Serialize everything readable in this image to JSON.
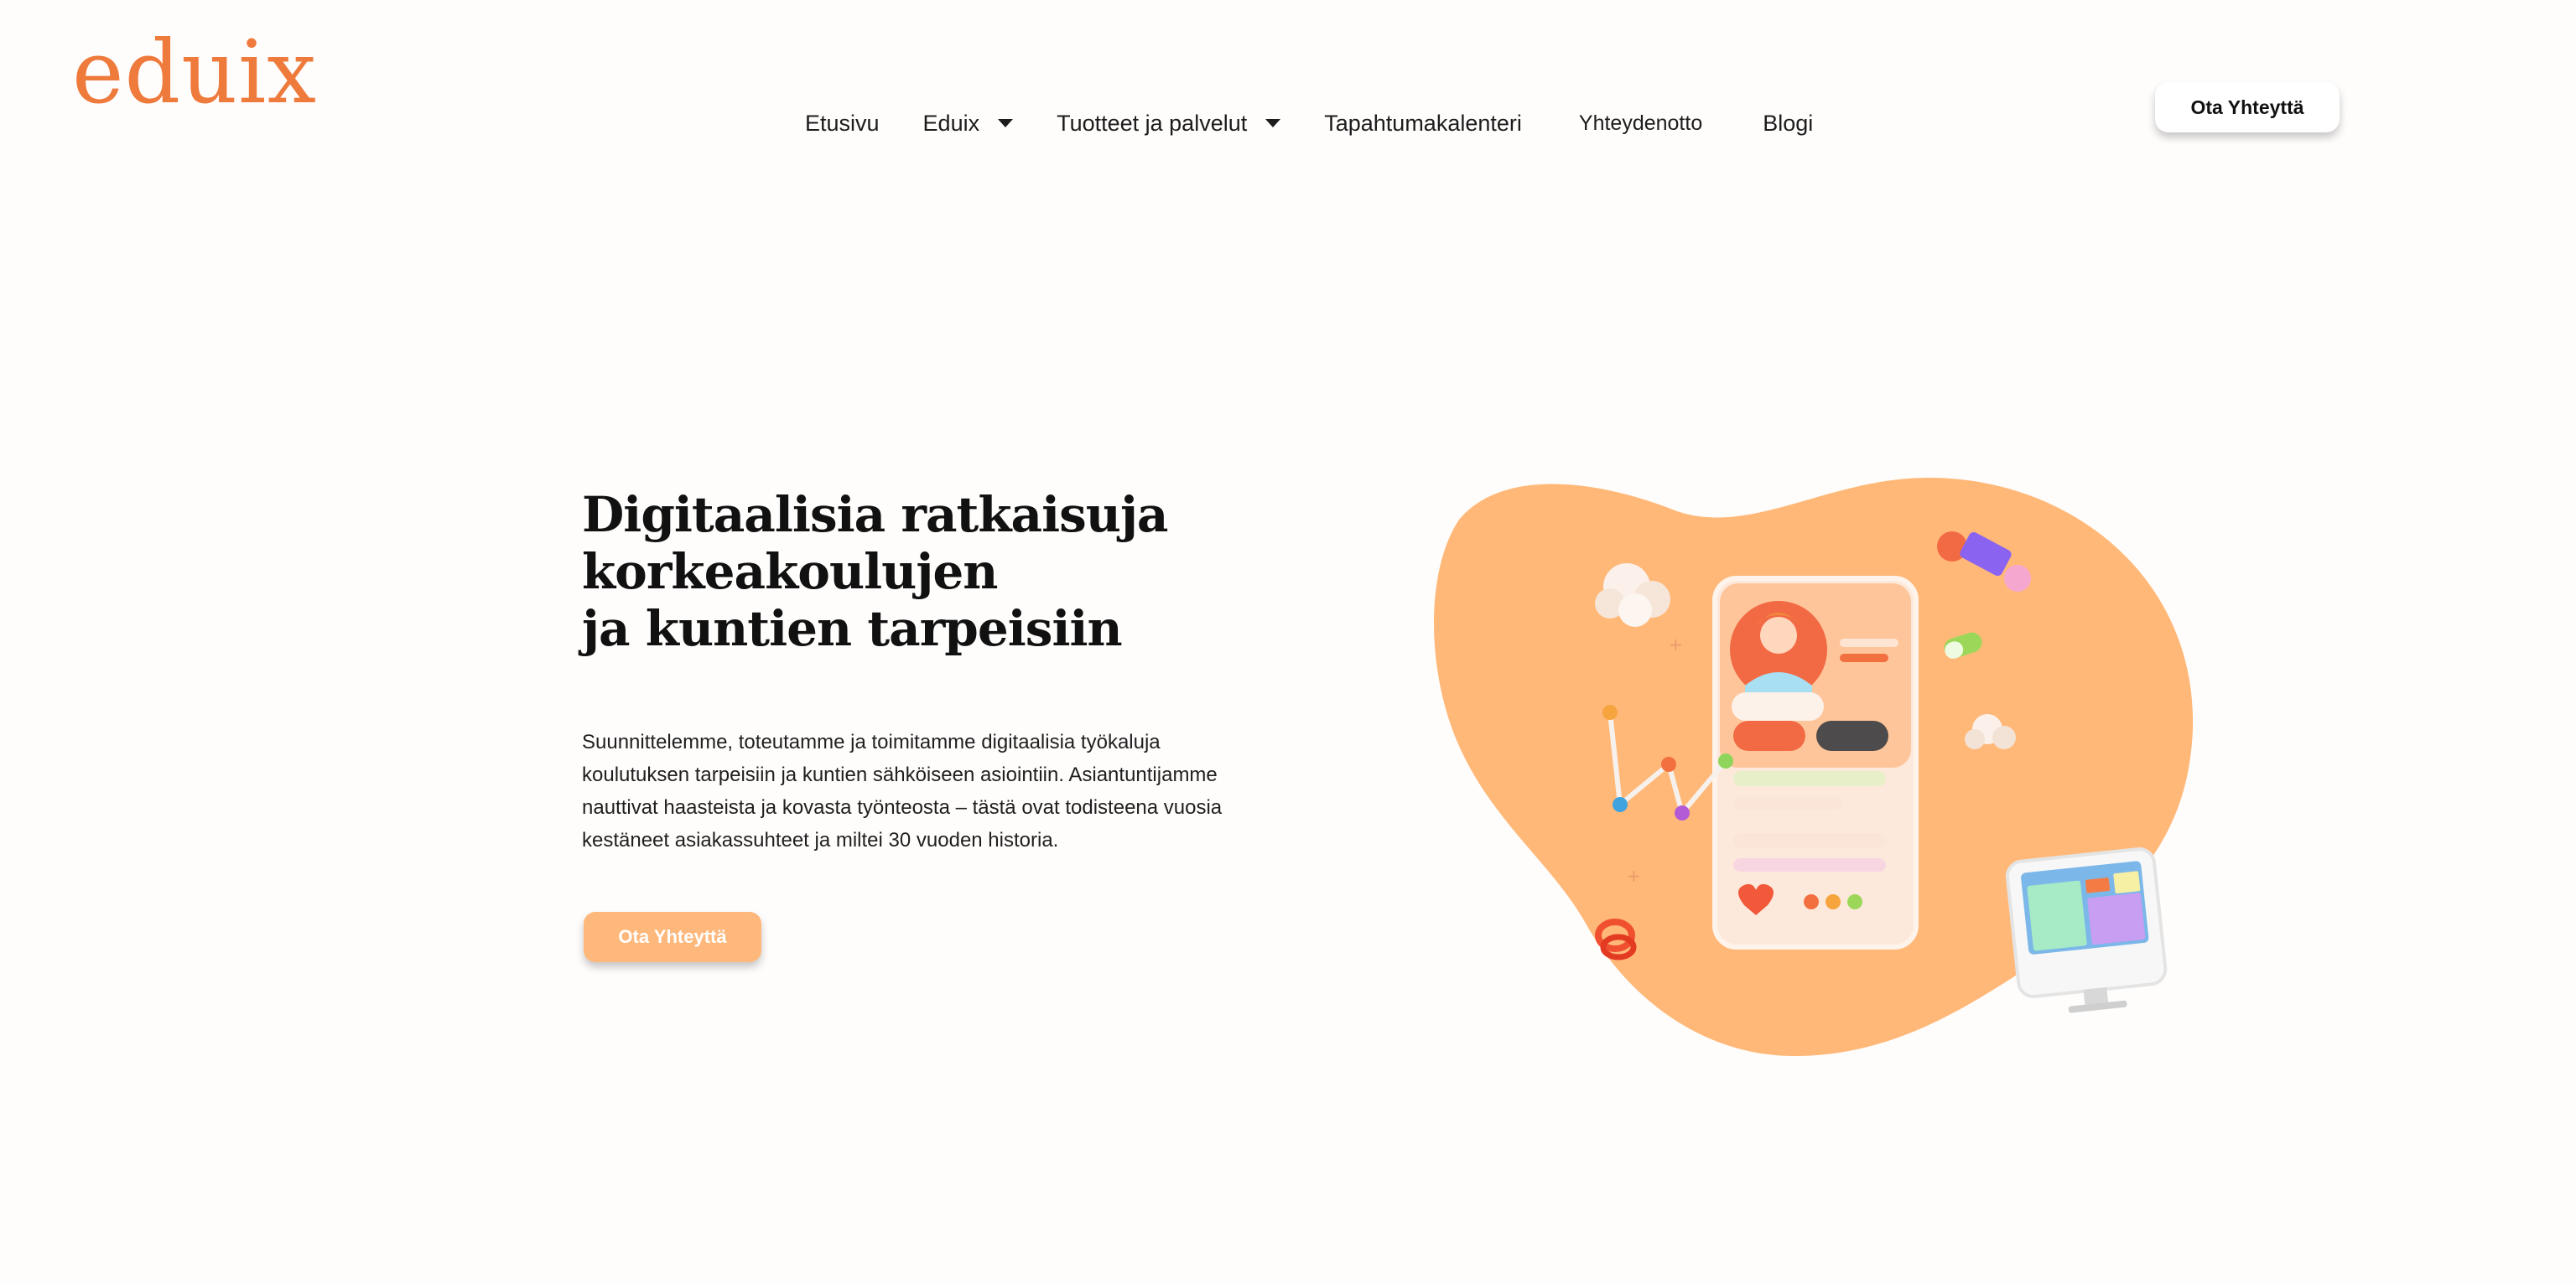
{
  "brand": {
    "logo_text": "eduix",
    "accent": "#ee7a3c",
    "blob": "#ffb878"
  },
  "nav": {
    "items": [
      {
        "label": "Etusivu",
        "has_dropdown": false
      },
      {
        "label": "Eduix",
        "has_dropdown": true
      },
      {
        "label": "Tuotteet ja palvelut",
        "has_dropdown": true
      },
      {
        "label": "Tapahtumakalenteri",
        "has_dropdown": false
      },
      {
        "label": "Yhteydenotto",
        "has_dropdown": false
      },
      {
        "label": "Blogi",
        "has_dropdown": false
      }
    ],
    "cta_label": "Ota Yhteyttä"
  },
  "hero": {
    "title_lines": [
      "Digitaalisia ratkaisuja",
      "korkeakoulujen",
      "ja kuntien tarpeisiin"
    ],
    "text_lines": [
      "Suunnittelemme, toteutamme ja toimitamme digitaalisia työkaluja",
      "koulutuksen tarpeisiin ja kuntien sähköiseen asiointiin. Asiantuntijamme",
      "nauttivat haasteista ja kovasta työnteosta – tästä ovat todisteena vuosia",
      "kestäneet asiakassuhteet ja miltei 30 vuoden historia."
    ],
    "cta_label": "Ota Yhteyttä",
    "cta_color": "#ffb87b"
  }
}
